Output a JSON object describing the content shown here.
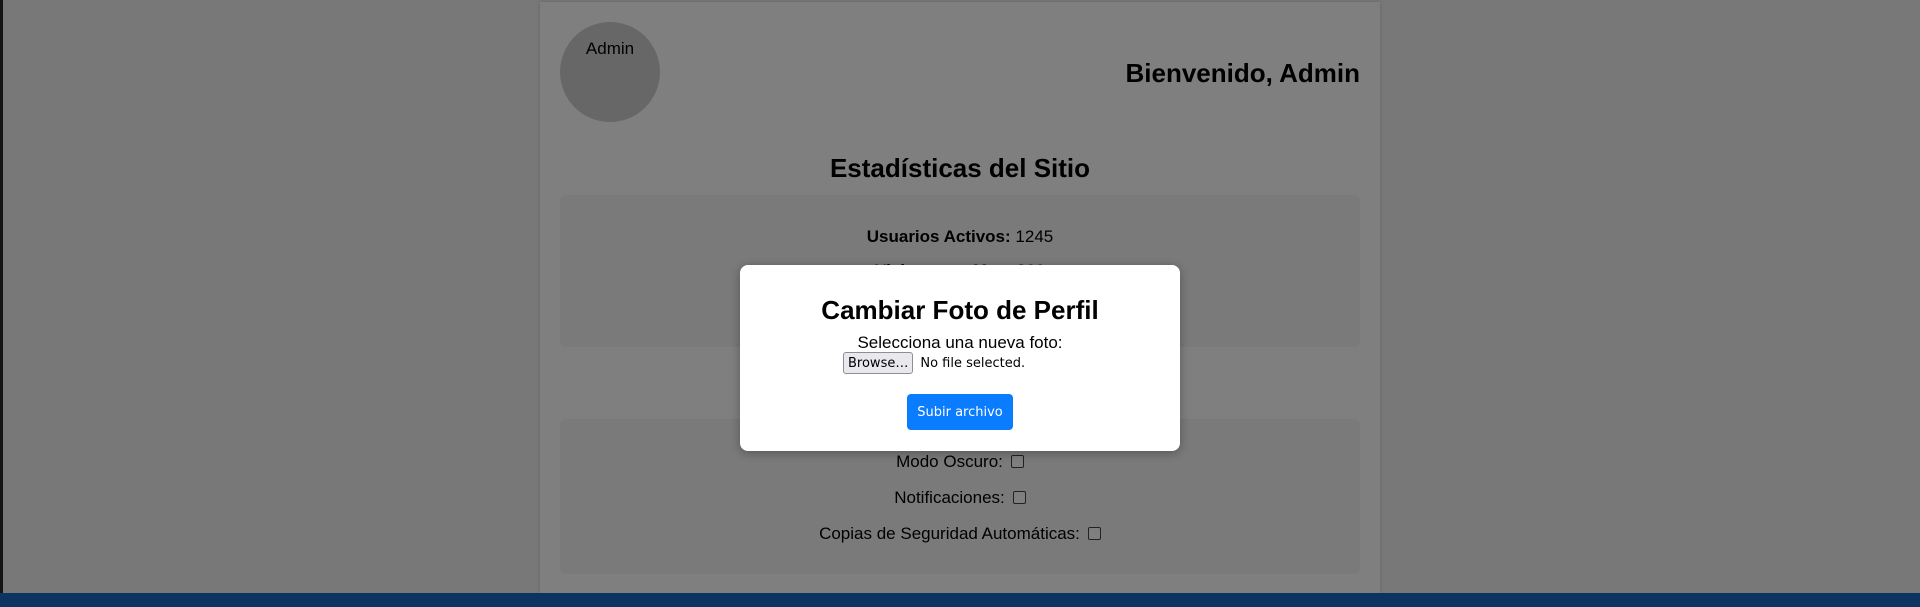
{
  "header": {
    "avatar_label": "Admin",
    "welcome": "Bienvenido, Admin"
  },
  "stats": {
    "title": "Estadísticas del Sitio",
    "items": [
      {
        "label": "Usuarios Activos:",
        "value": "1245"
      },
      {
        "label": "Visitas este Mes:",
        "value": "320"
      }
    ]
  },
  "settings": {
    "items": [
      {
        "label": "Modo Oscuro:",
        "checked": false
      },
      {
        "label": "Notificaciones:",
        "checked": false
      },
      {
        "label": "Copias de Seguridad Automáticas:",
        "checked": false
      }
    ]
  },
  "modal": {
    "title": "Cambiar Foto de Perfil",
    "label": "Selecciona una nueva foto:",
    "browse_label": "Browse…",
    "file_status": "No file selected.",
    "upload_label": "Subir archivo"
  },
  "colors": {
    "primary_button": "#0a7cff",
    "bottom_bar": "#1a66c0"
  }
}
